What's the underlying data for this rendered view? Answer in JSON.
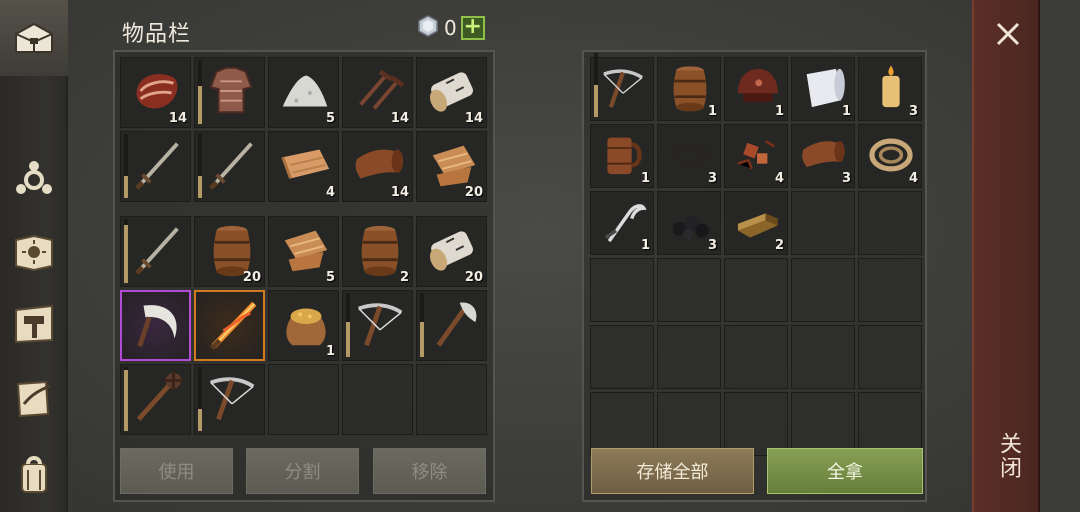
{
  "inventory": {
    "title": "物品栏",
    "gem_count": "0",
    "gem_icon": "gem-icon",
    "add_label": "+",
    "upper_slots": [
      {
        "icon": "meat-icon",
        "count": "14",
        "durability": null
      },
      {
        "icon": "chainmail-shirt-icon",
        "count": "",
        "durability": 0.6
      },
      {
        "icon": "salt-pile-icon",
        "count": "5",
        "durability": null
      },
      {
        "icon": "nails-icon",
        "count": "14",
        "durability": null
      },
      {
        "icon": "birch-log-icon",
        "count": "14",
        "durability": null
      },
      {
        "icon": "sword-icon",
        "count": "",
        "durability": 0.35
      },
      {
        "icon": "sword-icon",
        "count": "",
        "durability": 0.35
      },
      {
        "icon": "cloth-icon",
        "count": "4",
        "durability": null
      },
      {
        "icon": "leather-icon",
        "count": "14",
        "durability": null
      },
      {
        "icon": "fur-rag-icon",
        "count": "20",
        "durability": null
      }
    ],
    "lower_slots": [
      {
        "icon": "sword-icon",
        "count": "",
        "durability": 0.9,
        "rarity": ""
      },
      {
        "icon": "barrel-icon",
        "count": "20",
        "durability": null,
        "rarity": ""
      },
      {
        "icon": "fur-rag-icon",
        "count": "5",
        "durability": null,
        "rarity": ""
      },
      {
        "icon": "barrel-icon",
        "count": "2",
        "durability": null,
        "rarity": ""
      },
      {
        "icon": "birch-log-icon",
        "count": "20",
        "durability": null,
        "rarity": ""
      },
      {
        "icon": "sickle-icon",
        "count": "",
        "durability": null,
        "rarity": "epic"
      },
      {
        "icon": "flaming-sword-icon",
        "count": "",
        "durability": null,
        "rarity": "rare"
      },
      {
        "icon": "grain-sack-icon",
        "count": "1",
        "durability": null,
        "rarity": ""
      },
      {
        "icon": "crossbow-icon",
        "count": "",
        "durability": 0.55,
        "rarity": ""
      },
      {
        "icon": "axe-icon",
        "count": "",
        "durability": 0.55,
        "rarity": ""
      },
      {
        "icon": "mace-icon",
        "count": "",
        "durability": 0.95,
        "rarity": ""
      },
      {
        "icon": "crossbow-icon",
        "count": "",
        "durability": 0.35,
        "rarity": ""
      },
      {
        "icon": "",
        "count": "",
        "durability": null,
        "rarity": ""
      },
      {
        "icon": "",
        "count": "",
        "durability": null,
        "rarity": ""
      },
      {
        "icon": "",
        "count": "",
        "durability": null,
        "rarity": ""
      }
    ],
    "buttons": {
      "use": "使用",
      "split": "分割",
      "remove": "移除"
    }
  },
  "storage": {
    "slots": [
      {
        "icon": "crossbow-icon",
        "count": "",
        "durability": 0.5
      },
      {
        "icon": "barrel-icon",
        "count": "1",
        "durability": null
      },
      {
        "icon": "helmet-icon",
        "count": "1",
        "durability": null
      },
      {
        "icon": "paper-roll-icon",
        "count": "1",
        "durability": null
      },
      {
        "icon": "candle-icon",
        "count": "3",
        "durability": null
      },
      {
        "icon": "wooden-mug-icon",
        "count": "1",
        "durability": null
      },
      {
        "icon": "wire-icon",
        "count": "3",
        "durability": null
      },
      {
        "icon": "scrap-parts-icon",
        "count": "4",
        "durability": null
      },
      {
        "icon": "leather-icon",
        "count": "3",
        "durability": null
      },
      {
        "icon": "rope-icon",
        "count": "4",
        "durability": null
      },
      {
        "icon": "hook-blade-icon",
        "count": "1",
        "durability": null
      },
      {
        "icon": "coal-icon",
        "count": "3",
        "durability": null
      },
      {
        "icon": "bronze-ingot-icon",
        "count": "2",
        "durability": null
      },
      {
        "icon": "",
        "count": "",
        "durability": null
      },
      {
        "icon": "",
        "count": "",
        "durability": null
      }
    ],
    "empty_rows": 3,
    "buttons": {
      "store_all": "存储全部",
      "take_all": "全拿"
    }
  },
  "sidebar": [
    {
      "icon": "chest-icon",
      "active": true
    },
    {
      "icon": "biohazard-icon",
      "active": false
    },
    {
      "icon": "sun-book-icon",
      "active": false
    },
    {
      "icon": "hammer-map-icon",
      "active": false
    },
    {
      "icon": "quill-scroll-icon",
      "active": false
    },
    {
      "icon": "backpack-icon",
      "active": false
    }
  ],
  "close": {
    "label": "关闭",
    "icon": "close-icon"
  },
  "colors": {
    "epic": "#b14bd6",
    "rare": "#d07a22",
    "take_all": "#7a9446",
    "store_all": "#7f6c4c"
  }
}
